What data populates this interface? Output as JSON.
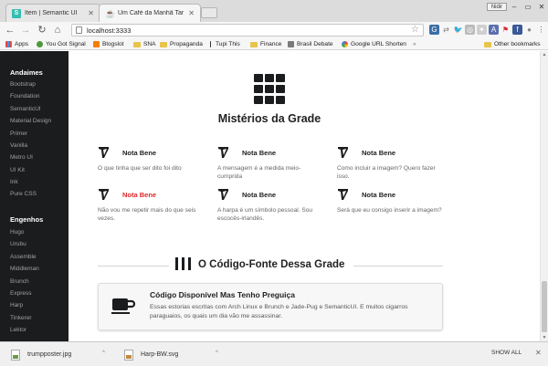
{
  "browser": {
    "tabs": [
      {
        "label": "Item | Semantic UI",
        "favicon": "S"
      },
      {
        "label": "Um Café da Manhã Tar",
        "favicon": "cup"
      }
    ],
    "profile_label": "Nidir",
    "url": "localhost:3333",
    "bookmarks": [
      {
        "label": "Apps"
      },
      {
        "label": "You Got Signal"
      },
      {
        "label": "Blogslot"
      },
      {
        "label": "SNA"
      },
      {
        "label": "Propaganda"
      },
      {
        "label": "Tupi This"
      },
      {
        "label": "Finance"
      },
      {
        "label": "Brasil Debate"
      },
      {
        "label": "Google URL Shorten"
      },
      {
        "label": "Other bookmarks"
      }
    ]
  },
  "sidebar": {
    "group1_title": "Andaimes",
    "group1_items": [
      "Bootstrap",
      "Foundation",
      "SemanticUI",
      "Material Design",
      "Primer",
      "Vanilla",
      "Metro UI",
      "UI Kit",
      "Ink",
      "Pure CSS"
    ],
    "group2_title": "Engenhos",
    "group2_items": [
      "Hugo",
      "Urubu",
      "Assemble",
      "Middleman",
      "Brunch",
      "Express",
      "Harp",
      "Tinkerer",
      "Lektor"
    ]
  },
  "main": {
    "section_title": "Mistérios da Grade",
    "cards": [
      {
        "title": "Nota Bene",
        "desc": "O que tinha que ser dito foi dito",
        "red": false
      },
      {
        "title": "Nota Bene",
        "desc": "A mensagem é a medida meio-cumprida",
        "red": false
      },
      {
        "title": "Nota Bene",
        "desc": "Como incluir a imagem? Quero fazer isso.",
        "red": false
      },
      {
        "title": "Nota Bene",
        "desc": "Não vou me repetir mais do que seis vezes.",
        "red": true
      },
      {
        "title": "Nota Bene",
        "desc": "A harpa é um símbolo pessoal. Sou escocês-irlandês.",
        "red": false
      },
      {
        "title": "Nota Bene",
        "desc": "Será que eu consigo inserir a imagem?",
        "red": false
      }
    ],
    "code_heading": "O Código-Fonte Dessa Grade",
    "segment_title": "Código Disponível Mas Tenho Preguiça",
    "segment_text": "Essas estorias escritas com Arch Linux e Brunch e Jade-Pug e SemanticUI. E muitos cigarros paraguaios, os quais um dia vão me assassinar."
  },
  "downloads": {
    "files": [
      "trumpposter.jpg",
      "Harp-BW.svg"
    ],
    "show_all": "SHOW ALL"
  },
  "colors": {
    "sidebar_bg": "#1b1c1d",
    "accent_red": "#db2828"
  }
}
